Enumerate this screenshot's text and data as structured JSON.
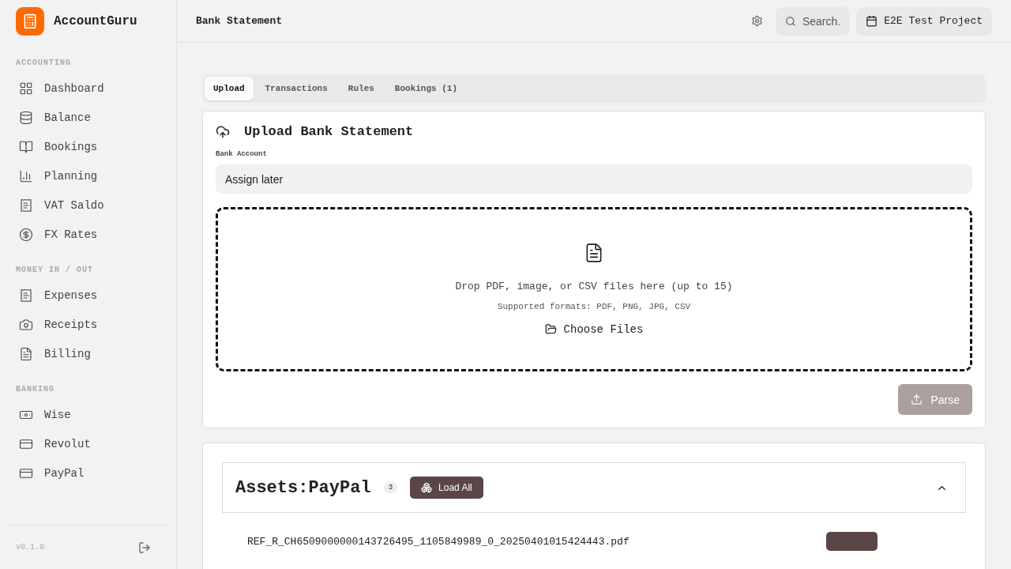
{
  "app": {
    "name": "AccountGuru",
    "version": "v0.1.0"
  },
  "sidebar": {
    "sections": [
      {
        "title": "ACCOUNTING",
        "items": [
          {
            "label": "Dashboard",
            "selected": false
          },
          {
            "label": "Balance",
            "selected": false
          },
          {
            "label": "Bookings",
            "selected": false
          },
          {
            "label": "Planning",
            "selected": false
          },
          {
            "label": "VAT Saldo",
            "selected": false
          },
          {
            "label": "FX Rates",
            "selected": false
          }
        ]
      },
      {
        "title": "MONEY IN / OUT",
        "items": [
          {
            "label": "Expenses",
            "selected": false
          },
          {
            "label": "Receipts",
            "selected": false
          },
          {
            "label": "Billing",
            "selected": false
          }
        ]
      },
      {
        "title": "BANKING",
        "items": [
          {
            "label": "Wise",
            "selected": false
          },
          {
            "label": "Revolut",
            "selected": false
          },
          {
            "label": "PayPal",
            "selected": false
          }
        ]
      }
    ]
  },
  "header": {
    "title": "Bank Statement",
    "search": {
      "placeholder": "Search."
    },
    "project": "E2E Test Project"
  },
  "tabs": [
    {
      "label": "Upload",
      "selected": true
    },
    {
      "label": "Transactions",
      "selected": false
    },
    {
      "label": "Rules",
      "selected": false
    },
    {
      "label": "Bookings (1)",
      "selected": false
    }
  ],
  "upload": {
    "title": "Upload Bank Statement",
    "field_label": "Bank Account",
    "field_value": "Assign later",
    "drop_text": "Drop PDF, image, or CSV files here (up to 15)",
    "formats": "Supported formats: PDF, PNG, JPG, CSV",
    "choose": "Choose Files",
    "parse": {
      "label": "Parse",
      "disabled": true
    }
  },
  "account": {
    "name": "Assets:PayPal",
    "count": "3",
    "load_all": "Load All",
    "expanded": true,
    "files": [
      {
        "name": "REF_R_CH6509000000143726495_1105849989_0_20250401015424443.pdf"
      }
    ]
  }
}
